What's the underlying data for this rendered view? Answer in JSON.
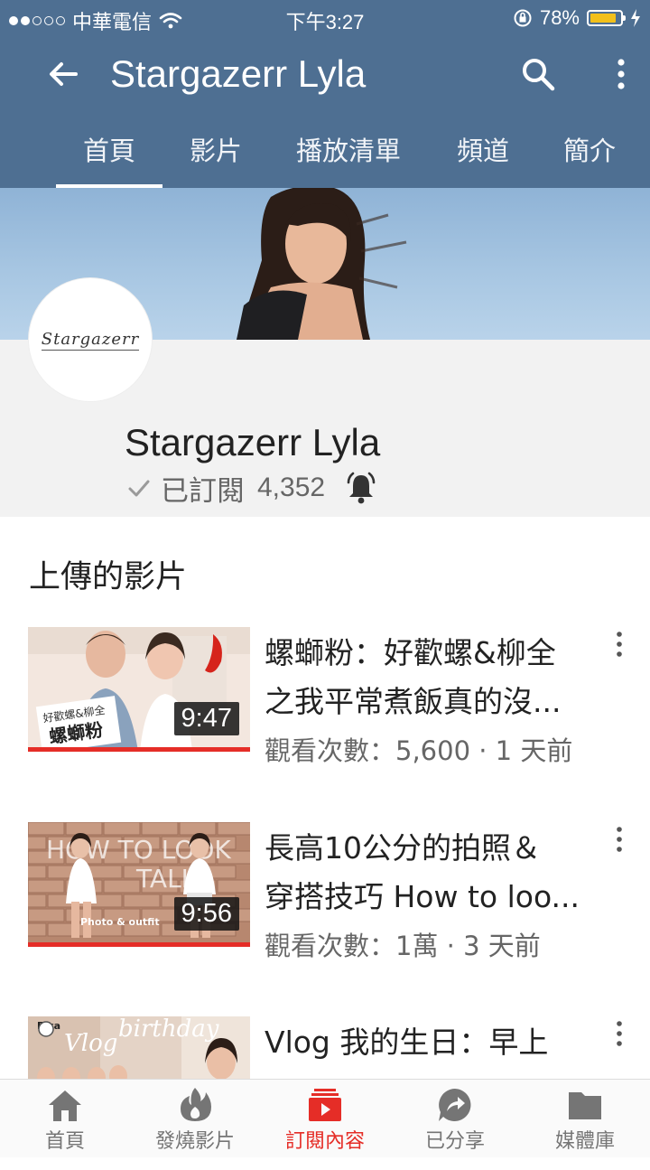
{
  "status_bar": {
    "carrier": "中華電信",
    "time": "下午3:27",
    "battery": "78%",
    "signal_bars": 2
  },
  "header": {
    "title": "Stargazerr Lyla",
    "tabs": [
      "首頁",
      "影片",
      "播放清單",
      "頻道",
      "簡介"
    ],
    "active_tab": 0
  },
  "channel": {
    "avatar_text": "Stargazerr",
    "name": "Stargazerr Lyla",
    "subscribed_label": "已訂閱",
    "subscriber_count": "4,352"
  },
  "section_title": "上傳的影片",
  "videos": [
    {
      "title_line1": "螺螄粉：好歡螺&柳全",
      "title_line2": "之我平常煮飯真的沒...",
      "meta": "觀看次數：5,600 · 1 天前",
      "duration": "9:47",
      "thumb_text_1": "好歡螺&柳全",
      "thumb_text_2": "螺螄粉"
    },
    {
      "title_line1": "長高10公分的拍照＆",
      "title_line2": "穿搭技巧 How to loo...",
      "meta": "觀看次數：1萬 · 3 天前",
      "duration": "9:56",
      "thumb_text_1": "HOW TO LOOK",
      "thumb_text_2": "TALL",
      "thumb_text_3": "Photo & outfit"
    },
    {
      "title_line1": "Vlog 我的生日：早上",
      "title_line2": "",
      "meta": "",
      "duration": "",
      "thumb_text_1": "birthday",
      "thumb_text_2": "Fika",
      "thumb_text_3": "Vlog"
    }
  ],
  "bottom_nav": {
    "items": [
      {
        "label": "首頁",
        "icon": "home-icon"
      },
      {
        "label": "發燒影片",
        "icon": "flame-icon"
      },
      {
        "label": "訂閱內容",
        "icon": "subscriptions-icon"
      },
      {
        "label": "已分享",
        "icon": "shared-icon"
      },
      {
        "label": "媒體庫",
        "icon": "folder-icon"
      }
    ],
    "active_index": 2
  },
  "colors": {
    "app_bar": "#4e6f92",
    "accent": "#e52d27",
    "battery": "#f2c01b"
  }
}
